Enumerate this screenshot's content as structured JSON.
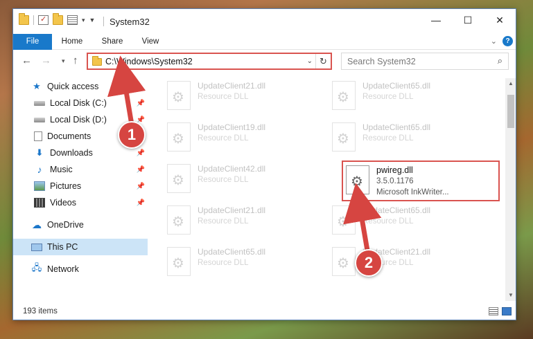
{
  "window": {
    "title": "System32",
    "controls": {
      "minimize": "—",
      "maximize": "☐",
      "close": "✕"
    }
  },
  "ribbon": {
    "tabs": [
      {
        "label": "File",
        "active": true
      },
      {
        "label": "Home"
      },
      {
        "label": "Share"
      },
      {
        "label": "View"
      }
    ],
    "help": "?"
  },
  "nav": {
    "address": "C:\\Windows\\System32",
    "search_placeholder": "Search System32"
  },
  "sidebar": {
    "items": [
      {
        "label": "Quick access",
        "icon": "star-icon"
      },
      {
        "label": "Local Disk (C:)",
        "icon": "drive-icon",
        "pinned": true
      },
      {
        "label": "Local Disk (D:)",
        "icon": "drive-icon",
        "pinned": true
      },
      {
        "label": "Documents",
        "icon": "documents-icon",
        "pinned": true
      },
      {
        "label": "Downloads",
        "icon": "download-icon",
        "pinned": true
      },
      {
        "label": "Music",
        "icon": "music-icon",
        "pinned": true
      },
      {
        "label": "Pictures",
        "icon": "pictures-icon",
        "pinned": true
      },
      {
        "label": "Videos",
        "icon": "videos-icon",
        "pinned": true
      },
      {
        "label": "OneDrive",
        "icon": "cloud-icon"
      },
      {
        "label": "This PC",
        "icon": "computer-icon",
        "selected": true
      },
      {
        "label": "Network",
        "icon": "network-icon"
      }
    ]
  },
  "files": [
    {
      "name": "UpdateClient21.dll",
      "desc": "Resource DLL"
    },
    {
      "name": "UpdateClient65.dll",
      "desc": "Resource DLL"
    },
    {
      "name": "UpdateClient19.dll",
      "desc": "Resource DLL"
    },
    {
      "name": "UpdateClient65.dll",
      "desc": "Resource DLL"
    },
    {
      "name": "UpdateClient42.dll",
      "desc": "Resource DLL"
    },
    {
      "name": "pwireg.dll",
      "desc": "3.5.0.1176",
      "desc2": "Microsoft InkWriter...",
      "highlight": true
    },
    {
      "name": "UpdateClient21.dll",
      "desc": "Resource DLL"
    },
    {
      "name": "UpdateClient65.dll",
      "desc": "Resource DLL"
    },
    {
      "name": "UpdateClient65.dll",
      "desc": "Resource DLL"
    },
    {
      "name": "UpdateClient21.dll",
      "desc": "Resource DLL"
    }
  ],
  "status": {
    "item_count": "193 items"
  },
  "annotations": {
    "step1": "1",
    "step2": "2",
    "color": "#d64541"
  }
}
